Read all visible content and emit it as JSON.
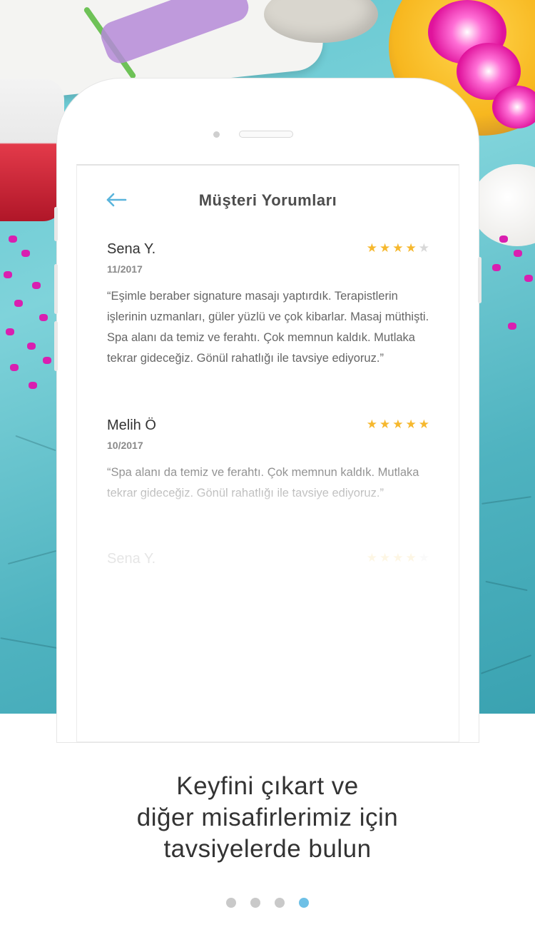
{
  "screen": {
    "title": "Müşteri Yorumları",
    "back_icon": "arrow-left-icon",
    "accent_color": "#5ab4dc",
    "star_color": "#f6b82e"
  },
  "reviews": [
    {
      "name": "Sena Y.",
      "date": "11/2017",
      "rating": 4,
      "max_rating": 5,
      "text": "“Eşimle beraber signature masajı yaptırdık. Terapistlerin işlerinin uzmanları, güler yüzlü ve çok kibarlar. Masaj müthişti. Spa alanı da temiz ve ferahtı. Çok memnun kaldık. Mutlaka tekrar gideceğiz. Gönül rahatlığı ile tavsiye ediyoruz.”"
    },
    {
      "name": "Melih Ö",
      "date": "10/2017",
      "rating": 5,
      "max_rating": 5,
      "text": "“Spa alanı da temiz ve ferahtı. Çok memnun kaldık. Mutlaka tekrar gideceğiz. Gönül rahatlığı ile tavsiye ediyoruz.”"
    },
    {
      "name": "Sena Y.",
      "rating": 4,
      "max_rating": 5
    }
  ],
  "caption": {
    "line1": "Keyfini çıkart ve",
    "line2": "diğer misafirlerimiz için",
    "line3": "tavsiyelerde bulun"
  },
  "pager": {
    "total": 4,
    "active_index": 3
  }
}
